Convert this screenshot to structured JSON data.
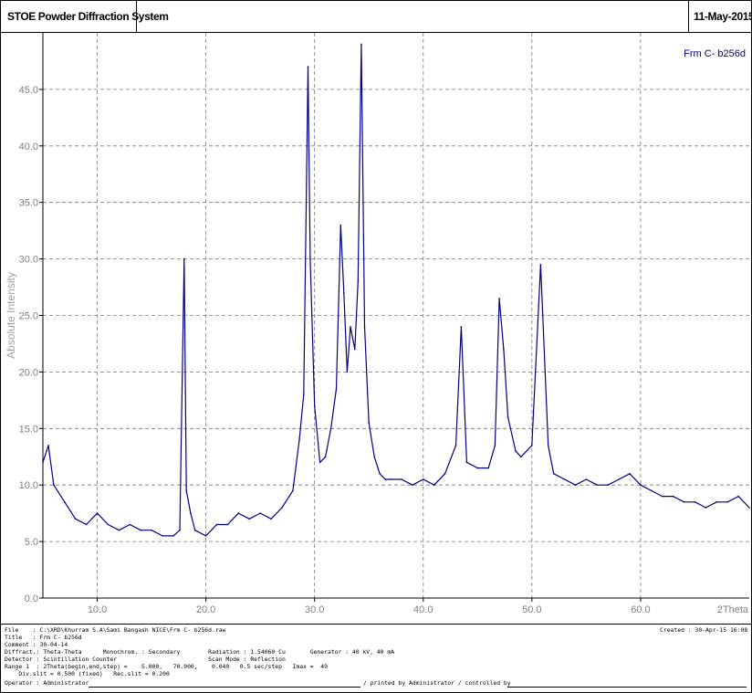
{
  "header": {
    "system_title": "STOE Powder Diffraction System",
    "date": "11-May-2015"
  },
  "chart_data": {
    "type": "line",
    "legend": "Frm C- b256d",
    "ylabel": "Absolute Intensity",
    "xlabel": "2Theta",
    "xlim": [
      5,
      70
    ],
    "ylim": [
      0,
      50
    ],
    "x_ticks": [
      "10.0",
      "20.0",
      "30.0",
      "40.0",
      "50.0",
      "60.0"
    ],
    "y_ticks": [
      "0.0",
      "5.0",
      "10.0",
      "15.0",
      "20.0",
      "25.0",
      "30.0",
      "35.0",
      "40.0",
      "45.0"
    ],
    "grid": true,
    "series_color": "#000080",
    "series": [
      {
        "name": "Frm C- b256d",
        "x": [
          5.0,
          5.5,
          6.0,
          7.0,
          8.0,
          9.0,
          10.0,
          11.0,
          12.0,
          13.0,
          14.0,
          15.0,
          16.0,
          17.0,
          17.6,
          18.0,
          18.2,
          18.6,
          19.0,
          20.0,
          21.0,
          22.0,
          23.0,
          24.0,
          25.0,
          26.0,
          27.0,
          28.0,
          28.6,
          29.0,
          29.4,
          29.6,
          30.0,
          30.5,
          31.0,
          31.5,
          32.0,
          32.4,
          32.7,
          33.0,
          33.3,
          33.7,
          34.0,
          34.3,
          34.6,
          35.0,
          35.5,
          36.0,
          36.5,
          37.0,
          38.0,
          39.0,
          40.0,
          41.0,
          42.0,
          43.0,
          43.5,
          44.0,
          45.0,
          46.0,
          46.6,
          47.0,
          47.4,
          47.8,
          48.5,
          49.0,
          50.0,
          50.8,
          51.5,
          52.0,
          53.0,
          54.0,
          55.0,
          56.0,
          57.0,
          58.0,
          59.0,
          60.0,
          61.0,
          62.0,
          63.0,
          64.0,
          65.0,
          66.0,
          67.0,
          68.0,
          69.0,
          70.0
        ],
        "y": [
          12.0,
          13.5,
          10.0,
          8.5,
          7.0,
          6.5,
          7.5,
          6.5,
          6.0,
          6.5,
          6.0,
          6.0,
          5.5,
          5.5,
          6.0,
          30.0,
          9.5,
          7.5,
          6.0,
          5.5,
          6.5,
          6.5,
          7.5,
          7.0,
          7.5,
          7.0,
          8.0,
          9.5,
          14.0,
          18.0,
          47.0,
          30.0,
          17.0,
          12.0,
          12.5,
          15.0,
          18.5,
          33.0,
          27.0,
          20.0,
          24.0,
          22.0,
          28.0,
          49.0,
          24.0,
          15.5,
          12.5,
          11.0,
          10.5,
          10.5,
          10.5,
          10.0,
          10.5,
          10.0,
          11.0,
          13.5,
          24.0,
          12.0,
          11.5,
          11.5,
          13.5,
          26.5,
          22.0,
          16.0,
          13.0,
          12.5,
          13.5,
          29.5,
          13.5,
          11.0,
          10.5,
          10.0,
          10.5,
          10.0,
          10.0,
          10.5,
          11.0,
          10.0,
          9.5,
          9.0,
          9.0,
          8.5,
          8.5,
          8.0,
          8.5,
          8.5,
          9.0,
          8.0
        ]
      }
    ]
  },
  "footer": {
    "file_line": "File    : C:\\XRD\\Khurram S.A\\Sami Bangash NICE\\Frm C- b256d.raw",
    "created": "Created : 30-Apr-15 16:08 :",
    "title_line": "Title   : Frm C- b256d",
    "comment_line": "Comment : 30-04-14",
    "diffract_line": "Diffract.: Theta-Theta      Monochrom. : Secondary        Radiation : 1.54060 Cu       Generator : 40 kV, 40 mA",
    "detector_line": "Detector : Scintillation Counter                          Scan Mode : Reflection",
    "range_line": "Range 1  : 2Theta(begin,end,step) =    5.000,   70.000,    0.040   0.5 sec/step   Imax =  49",
    "slit_line": "    Div.slit = 0.500 (fixed)   Rec.slit = 0.200",
    "operator_line": "Operator : Administrator",
    "printed_by": "/ printed by Administrator / controlled by"
  }
}
